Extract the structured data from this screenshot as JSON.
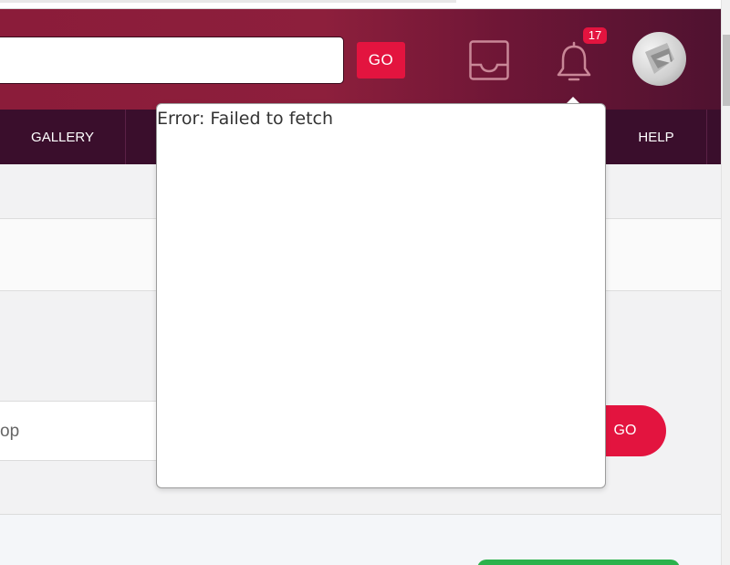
{
  "header": {
    "search": {
      "value": "",
      "placeholder": ""
    },
    "go_label": "GO",
    "notification_count": "17"
  },
  "nav": {
    "items": [
      {
        "label": "GALLERY"
      },
      {
        "label": "HELP"
      }
    ]
  },
  "popup": {
    "message": "Error: Failed to fetch"
  },
  "body": {
    "field_text": "op",
    "go_label": "GO"
  },
  "colors": {
    "brand": "#8b1c3a",
    "accent": "#e3143f",
    "nav_bg": "#3a0e2c",
    "success": "#2bb24c"
  },
  "icons": [
    "inbox-icon",
    "bell-icon",
    "avatar"
  ]
}
